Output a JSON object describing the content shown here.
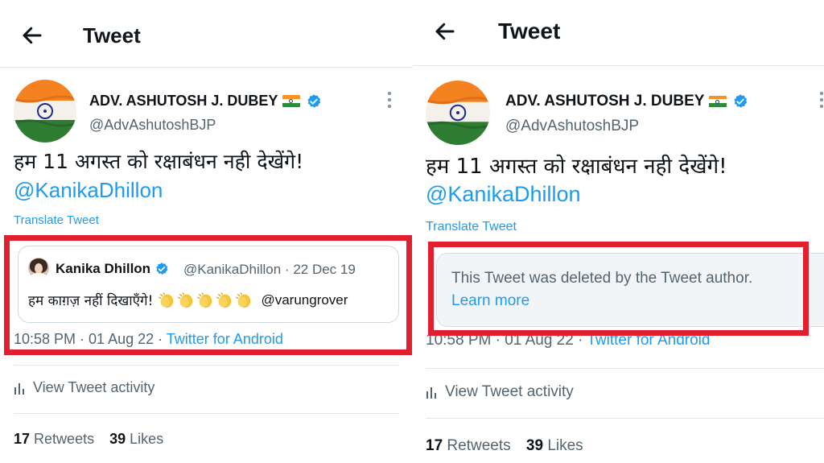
{
  "accent_color": "#1d9bf0",
  "highlight_color": "#e21f2e",
  "left_panel": {
    "header": {
      "title": "Tweet",
      "back_icon": "arrow-left-icon"
    },
    "author": {
      "name": "ADV. ASHUTOSH J. DUBEY",
      "handle": "@AdvAshutoshBJP",
      "flag_icon": "india-flag-icon",
      "verified_icon": "verified-badge-icon"
    },
    "tweet": {
      "text": "हम 11 अगस्त को रक्षाबंधन नही देखेंगे!",
      "mention": "@KanikaDhillon",
      "translate_label": "Translate Tweet"
    },
    "quoted_tweet": {
      "name": "Kanika Dhillon",
      "meta": "@KanikaDhillon · 22 Dec 19",
      "text": "हम काग़ज़ नहीं दिखाएँगे!",
      "emoji_icons": [
        "clapping-hands-icon",
        "clapping-hands-icon",
        "clapping-hands-icon",
        "clapping-hands-icon",
        "clapping-hands-icon"
      ],
      "mention": "@varungrover"
    },
    "timestamp": "10:58 PM · 01 Aug 22 · ",
    "source": "Twitter for Android",
    "activity_label": "View Tweet activity",
    "stats": {
      "retweets_count": "17",
      "retweets_label": "Retweets",
      "likes_count": "39",
      "likes_label": "Likes"
    }
  },
  "right_panel": {
    "header": {
      "title": "Tweet",
      "back_icon": "arrow-left-icon"
    },
    "author": {
      "name": "ADV. ASHUTOSH J. DUBEY",
      "handle": "@AdvAshutoshBJP",
      "flag_icon": "india-flag-icon",
      "verified_icon": "verified-badge-icon"
    },
    "tweet": {
      "text": "हम 11 अगस्त को रक्षाबंधन नही देखेंगे!",
      "mention": "@KanikaDhillon",
      "translate_label": "Translate Tweet"
    },
    "deleted_notice": {
      "text": "This Tweet was deleted by the Tweet author.",
      "link": "Learn more"
    },
    "timestamp": "10:58 PM · 01 Aug 22 · ",
    "source": "Twitter for Android",
    "activity_label": "View Tweet activity",
    "stats": {
      "retweets_count": "17",
      "retweets_label": "Retweets",
      "likes_count": "39",
      "likes_label": "Likes"
    }
  }
}
